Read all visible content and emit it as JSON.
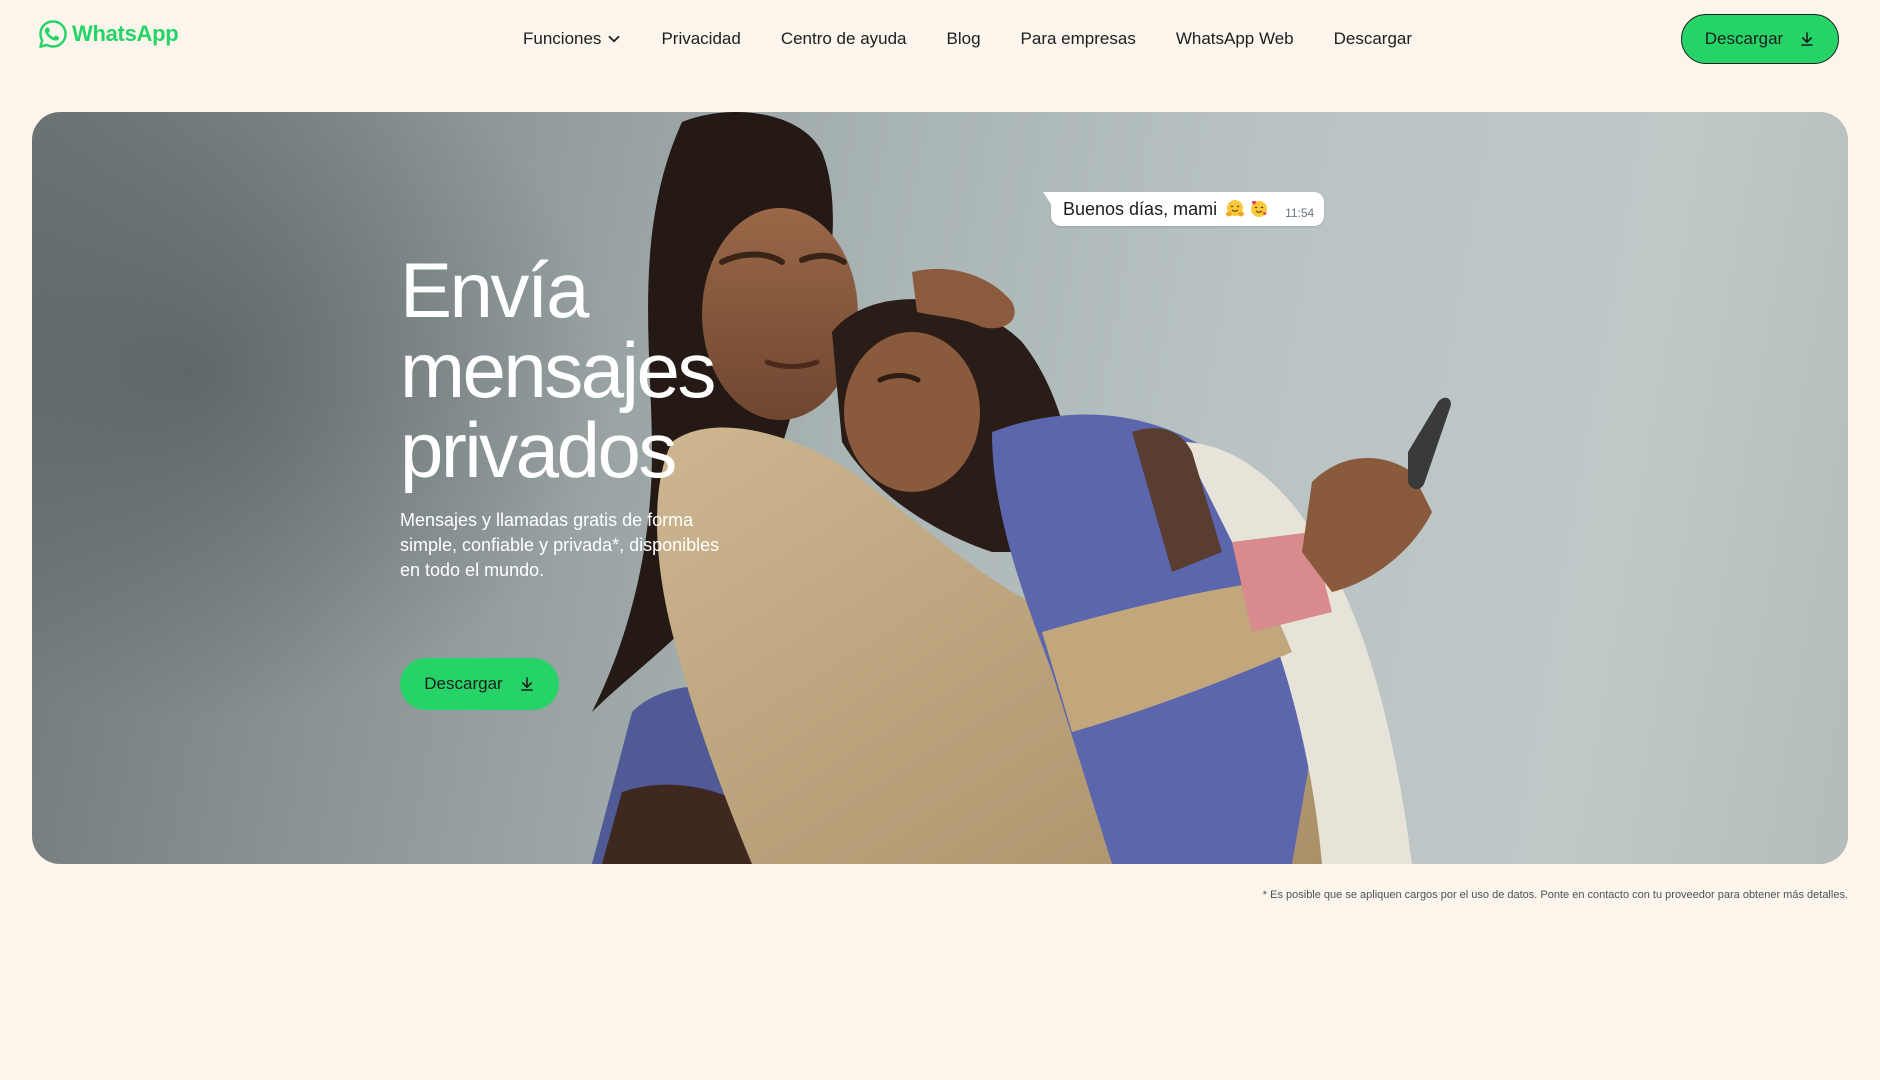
{
  "header": {
    "logo_text": "WhatsApp",
    "nav": [
      {
        "label": "Funciones",
        "has_dropdown": true
      },
      {
        "label": "Privacidad"
      },
      {
        "label": "Centro de ayuda"
      },
      {
        "label": "Blog"
      },
      {
        "label": "Para empresas"
      },
      {
        "label": "WhatsApp Web"
      },
      {
        "label": "Descargar"
      }
    ],
    "cta_label": "Descargar"
  },
  "hero": {
    "title_lines": [
      "Envía",
      "mensajes",
      "privados"
    ],
    "subtitle": "Mensajes y llamadas gratis de forma simple, confiable y privada*, disponibles en todo el mundo.",
    "cta_label": "Descargar",
    "chat_bubble": {
      "text": "Buenos días, mami",
      "emojis": [
        "hugging-face-emoji",
        "smiling-face-with-hearts-emoji"
      ],
      "time": "11:54"
    }
  },
  "footnote": "* Es posible que se apliquen cargos por el uso de datos. Ponte en contacto con tu proveedor para obtener más detalles.",
  "colors": {
    "brand_green": "#25d366",
    "page_background": "#fcf5eb",
    "text_dark": "#1c1e21"
  },
  "icons": {
    "logo": "whatsapp-logo-icon",
    "dropdown": "chevron-down-icon",
    "download": "download-icon"
  }
}
